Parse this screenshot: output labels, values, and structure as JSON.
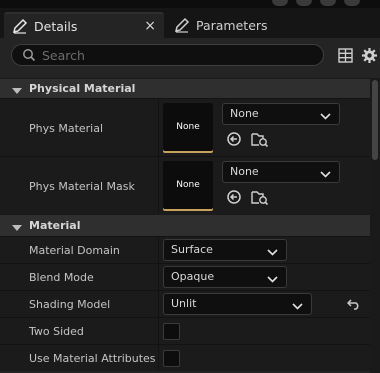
{
  "tabs": {
    "details": {
      "label": "Details",
      "close": "×"
    },
    "parameters": {
      "label": "Parameters"
    }
  },
  "search": {
    "placeholder": "Search",
    "value": ""
  },
  "categories": {
    "physical_material": {
      "title": "Physical Material",
      "phys_material": {
        "label": "Phys Material",
        "thumbnail_text": "None",
        "value": "None"
      },
      "phys_material_mask": {
        "label": "Phys Material Mask",
        "thumbnail_text": "None",
        "value": "None"
      }
    },
    "material": {
      "title": "Material",
      "material_domain": {
        "label": "Material Domain",
        "value": "Surface"
      },
      "blend_mode": {
        "label": "Blend Mode",
        "value": "Opaque"
      },
      "shading_model": {
        "label": "Shading Model",
        "value": "Unlit"
      },
      "two_sided": {
        "label": "Two Sided",
        "checked": false
      },
      "use_material_attributes": {
        "label": "Use Material Attributes",
        "checked": false
      }
    }
  },
  "colors": {
    "panel_bg": "#242424",
    "row_bg": "#1b1b1b",
    "category_bg": "#2f2f2f",
    "thumbnail_accent": "#c8a25a"
  }
}
